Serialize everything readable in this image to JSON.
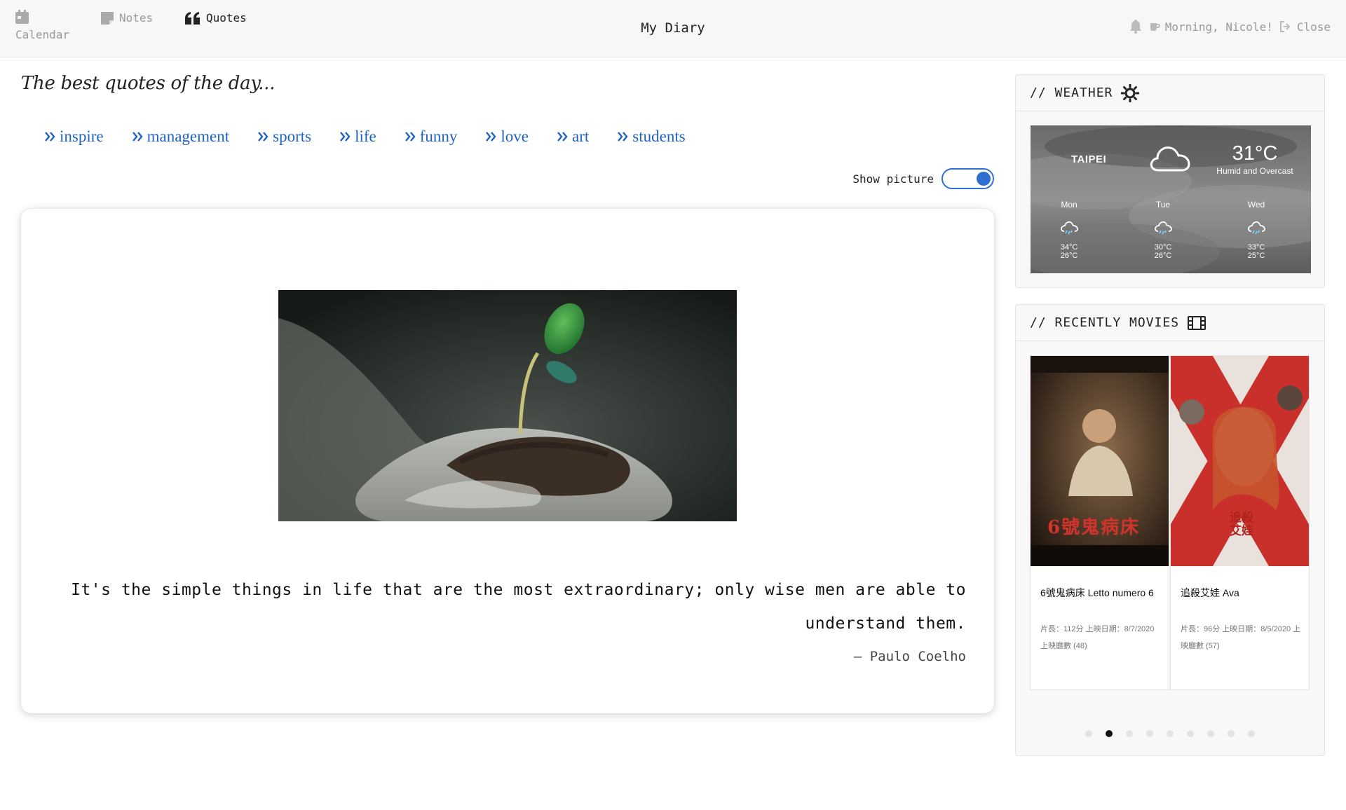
{
  "nav": {
    "calendar_label": "Calendar",
    "notes_label": "Notes",
    "quotes_label": "Quotes",
    "brand": "My Diary",
    "greeting": "Morning, Nicole!",
    "close_label": "Close"
  },
  "quotes": {
    "headline": "The best quotes of the day...",
    "categories": [
      "inspire",
      "management",
      "sports",
      "life",
      "funny",
      "love",
      "art",
      "students"
    ],
    "show_picture_label": "Show picture",
    "show_picture": true,
    "text": "It's the simple things in life that are the most extraordinary; only wise men are able to understand them.",
    "author": "—  Paulo Coelho"
  },
  "weather": {
    "title": "// WEATHER",
    "city": "TAIPEI",
    "temp": "31°C",
    "desc": "Humid and Overcast",
    "forecast": [
      {
        "day": "Mon",
        "hi": "34°C",
        "lo": "26°C"
      },
      {
        "day": "Tue",
        "hi": "30°C",
        "lo": "26°C"
      },
      {
        "day": "Wed",
        "hi": "33°C",
        "lo": "25°C"
      }
    ]
  },
  "movies": {
    "title": "// RECENTLY MOVIES",
    "items": [
      {
        "title": "6號鬼病床 Letto numero 6",
        "meta": "片長：112分 上映日期：8/7/2020 上映廳數 (48)",
        "poster_text": "6號鬼病床"
      },
      {
        "title": "追殺艾娃 Ava",
        "meta": "片長：96分 上映日期：8/5/2020 上映廳數 (57)",
        "poster_text": "追殺艾娃"
      }
    ],
    "dots_count": 9,
    "active_dot": 1
  },
  "colors": {
    "link_blue": "#1f63c2",
    "toggle_blue": "#2f6fd0"
  }
}
